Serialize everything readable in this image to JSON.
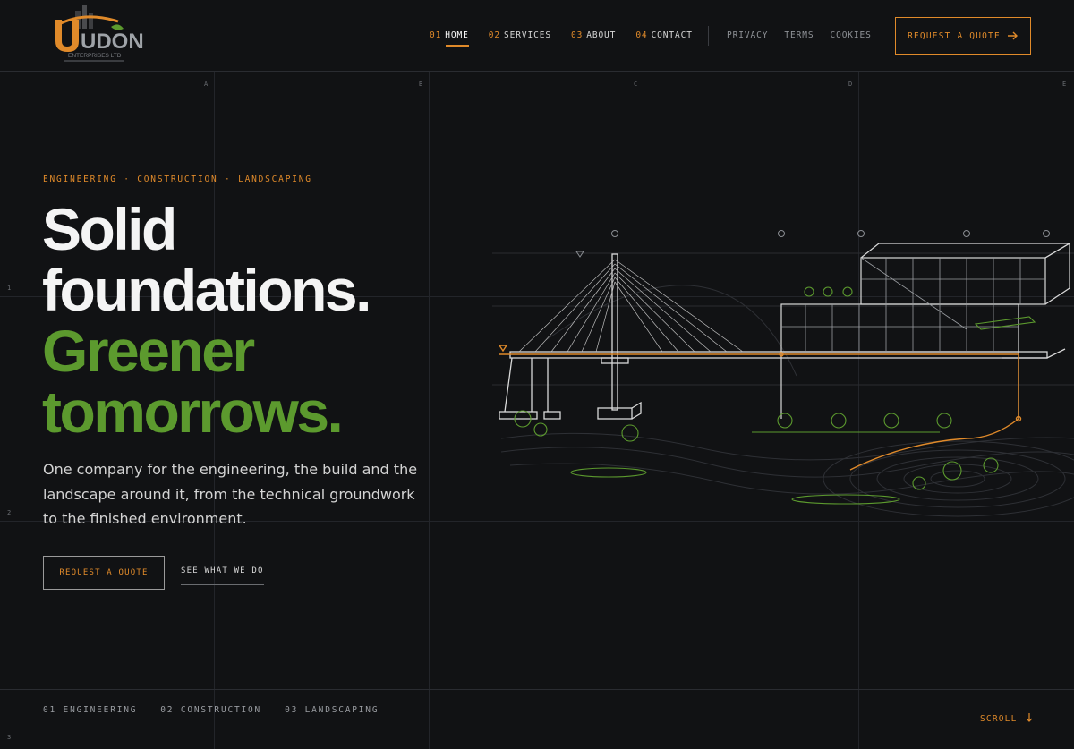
{
  "brand": {
    "logo_text": "UDON",
    "logo_subtext": "ENTERPRISES LTD",
    "colors": {
      "accent": "#e08a2a",
      "green": "#5c9a2e",
      "background": "#111214"
    }
  },
  "header": {
    "nav": [
      {
        "num": "01",
        "label": "HOME",
        "active": true
      },
      {
        "num": "02",
        "label": "SERVICES"
      },
      {
        "num": "03",
        "label": "ABOUT"
      },
      {
        "num": "04",
        "label": "CONTACT"
      }
    ],
    "secondary": [
      "PRIVACY",
      "TERMS",
      "COOKIES"
    ],
    "quote_button": {
      "label": "REQUEST A QUOTE",
      "icon": "arrow-right-icon"
    }
  },
  "grid": {
    "columns": [
      "A",
      "B",
      "C",
      "D",
      "E"
    ],
    "rows": [
      "1",
      "2",
      "3"
    ]
  },
  "hero": {
    "eyebrow": "ENGINEERING · CONSTRUCTION · LANDSCAPING",
    "headline_line1": "Solid",
    "headline_line2": "foundations.",
    "headline_line3": "Greener",
    "headline_line4": "tomorrows.",
    "lede": "One company for the engineering, the build and the landscape around it, from the technical groundwork to the finished environment.",
    "primary_cta": "REQUEST A QUOTE",
    "secondary_cta": "SEE WHAT WE DO"
  },
  "disciplines": [
    "01 ENGINEERING",
    "02 CONSTRUCTION",
    "03 LANDSCAPING"
  ],
  "scroll": {
    "label": "SCROLL",
    "icon": "arrow-down-icon"
  }
}
